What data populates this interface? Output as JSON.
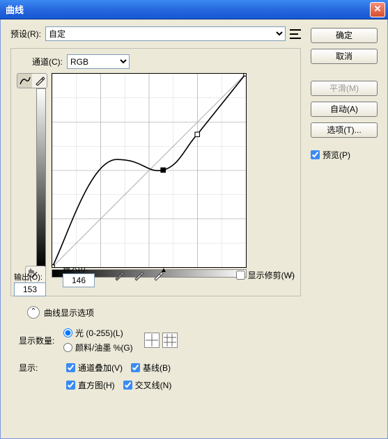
{
  "window": {
    "title": "曲线"
  },
  "preset": {
    "label": "预设(R):",
    "value": "自定"
  },
  "channel": {
    "label": "通道(C):",
    "value": "RGB"
  },
  "output": {
    "label": "输出(O):",
    "value": "153"
  },
  "input": {
    "label": "输入(I):",
    "value": "146"
  },
  "showClipping": {
    "label": "显示修剪(W)",
    "checked": false
  },
  "curveOptions": {
    "label": "曲线显示选项"
  },
  "displayAmount": {
    "label": "显示数量:",
    "options": [
      {
        "label": "光 (0-255)(L)",
        "checked": true
      },
      {
        "label": "颜料/油墨 %(G)",
        "checked": false
      }
    ]
  },
  "show": {
    "label": "显示:",
    "items": [
      {
        "label": "通道叠加(V)",
        "checked": true
      },
      {
        "label": "基线(B)",
        "checked": true
      },
      {
        "label": "直方图(H)",
        "checked": true
      },
      {
        "label": "交叉线(N)",
        "checked": true
      }
    ]
  },
  "buttons": {
    "ok": "确定",
    "cancel": "取消",
    "smooth": "平滑(M)",
    "auto": "自动(A)",
    "options": "选项(T)..."
  },
  "preview": {
    "label": "预览(P)",
    "checked": true
  },
  "chart_data": {
    "type": "line",
    "title": "",
    "xlabel": "输入",
    "ylabel": "输出",
    "xlim": [
      0,
      255
    ],
    "ylim": [
      0,
      255
    ],
    "series": [
      {
        "name": "baseline",
        "x": [
          0,
          255
        ],
        "y": [
          0,
          255
        ]
      },
      {
        "name": "curve",
        "x": [
          0,
          35,
          85,
          146,
          191,
          255
        ],
        "y": [
          0,
          60,
          142,
          128,
          175,
          255
        ]
      }
    ],
    "control_points": [
      {
        "x": 0,
        "y": 0
      },
      {
        "x": 146,
        "y": 128
      },
      {
        "x": 191,
        "y": 175
      },
      {
        "x": 255,
        "y": 255
      }
    ],
    "grid": {
      "major": 4,
      "minor": 2
    },
    "selected_point": {
      "input": 146,
      "output": 153
    }
  }
}
